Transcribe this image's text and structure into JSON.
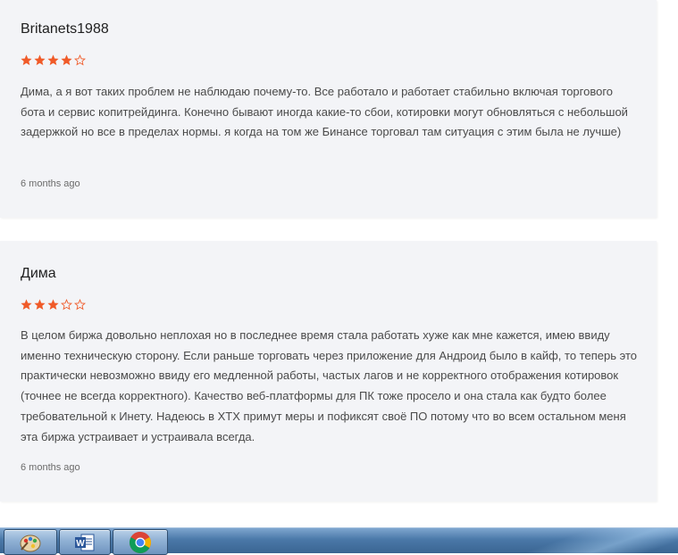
{
  "reviews": [
    {
      "author": "Britanets1988",
      "rating": 4,
      "max_rating": 5,
      "text": "Дима, а я вот таких проблем не наблюдаю почему-то. Все работало и работает стабильно включая торгового бота и сервис копитрейдинга. Конечно бывают иногда какие-то сбои, котировки могут обновляться с небольшой задержкой но все в пределах нормы. я когда на том же Бинансе торговал там ситуация с этим была не лучше)",
      "date": "6 months ago"
    },
    {
      "author": "Дима",
      "rating": 3,
      "max_rating": 5,
      "text": "В целом биржа довольно неплохая но в последнее время стала работать хуже как мне кажется, имею ввиду именно техническую сторону. Если раньше торговать через приложение для Андроид было в кайф, то теперь это практически невозможно ввиду его медленной работы, частых лагов и не корректного отображения котировок (точнее не всегда корректного). Качество веб-платформы для ПК тоже просело и она стала как будто более требовательной к Инету. Надеюсь в XTX примут меры и пофиксят своё ПО потому что во всем остальном меня эта биржа устраивает и устраивала всегда.",
      "date": "6 months ago"
    }
  ],
  "taskbar": {
    "items": [
      {
        "name": "paint-icon"
      },
      {
        "name": "word-icon"
      },
      {
        "name": "chrome-icon"
      }
    ]
  },
  "colors": {
    "star": "#f05a28",
    "card_bg": "#f3f4f7",
    "text": "#4a4a4a"
  }
}
